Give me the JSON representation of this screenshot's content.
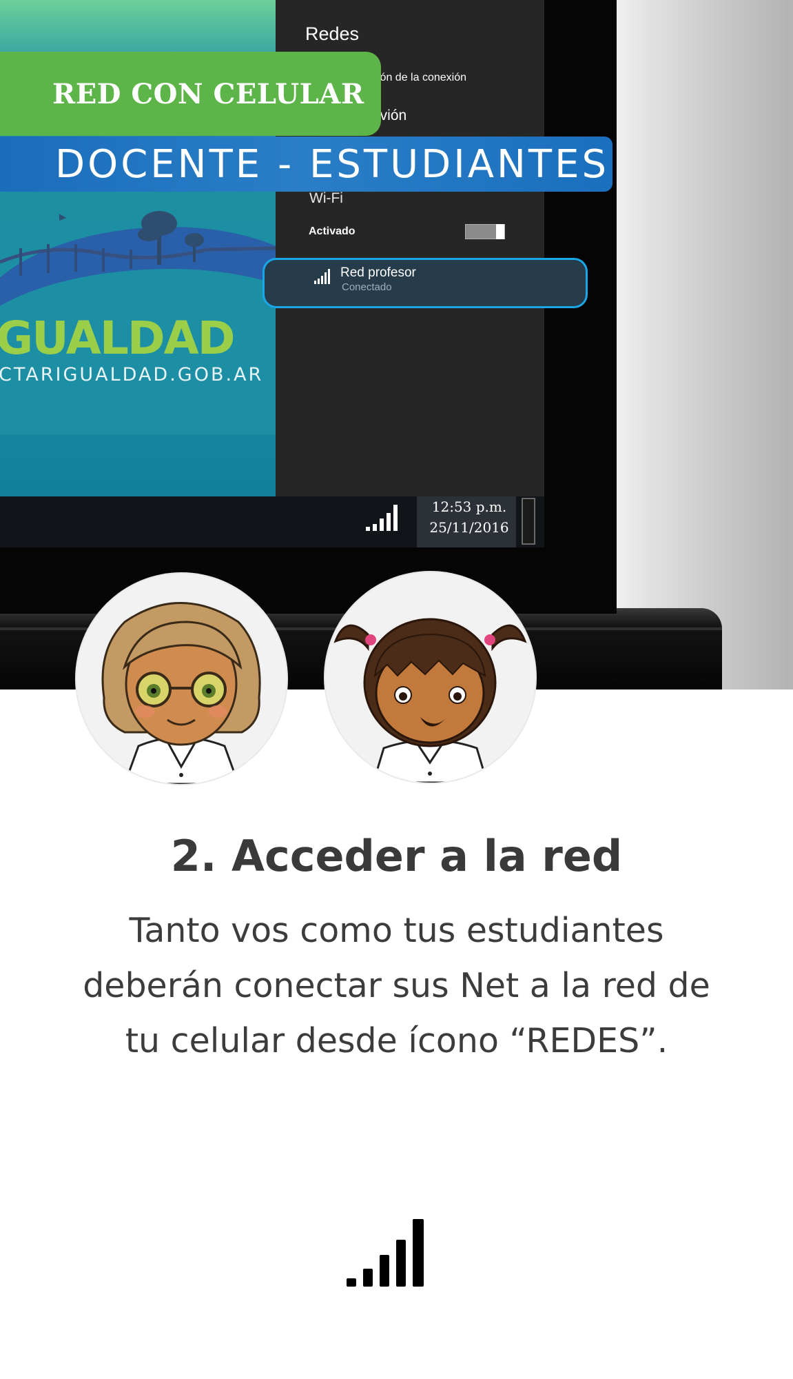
{
  "banner": {
    "primary": "RED CON CELULAR",
    "secondary": "DOCENTE - ESTUDIANTES"
  },
  "desktop": {
    "logo_text": "GUALDAD",
    "url_text": "CTARIGUALDAD.GOB.AR"
  },
  "network_panel": {
    "title": "Redes",
    "connection_partial": "ción de la conexión",
    "airplane_partial": "avión",
    "wifi_label": "Wi-Fi",
    "wifi_state": "Activado",
    "wifi_on": true,
    "network": {
      "name": "Red profesor",
      "status": "Conectado",
      "icon": "signal-bars-icon"
    }
  },
  "taskbar": {
    "icon": "signal-bars-icon",
    "time": "12:53 p.m.",
    "date": "25/11/2016"
  },
  "avatars": [
    {
      "role": "teacher",
      "icon": "teacher-avatar-icon"
    },
    {
      "role": "student",
      "icon": "student-avatar-icon"
    }
  ],
  "instructions": {
    "title": "2. Acceder a la red",
    "line1": "Tanto vos como tus estudiantes",
    "line2": "deberán conectar sus Net a la red de",
    "line3": "tu celular desde ícono “REDES”."
  },
  "colors": {
    "banner_green": "#5db549",
    "banner_blue": "#1b6dbb",
    "selection_outline": "#1aa7e8",
    "panel_background": "#262626"
  }
}
